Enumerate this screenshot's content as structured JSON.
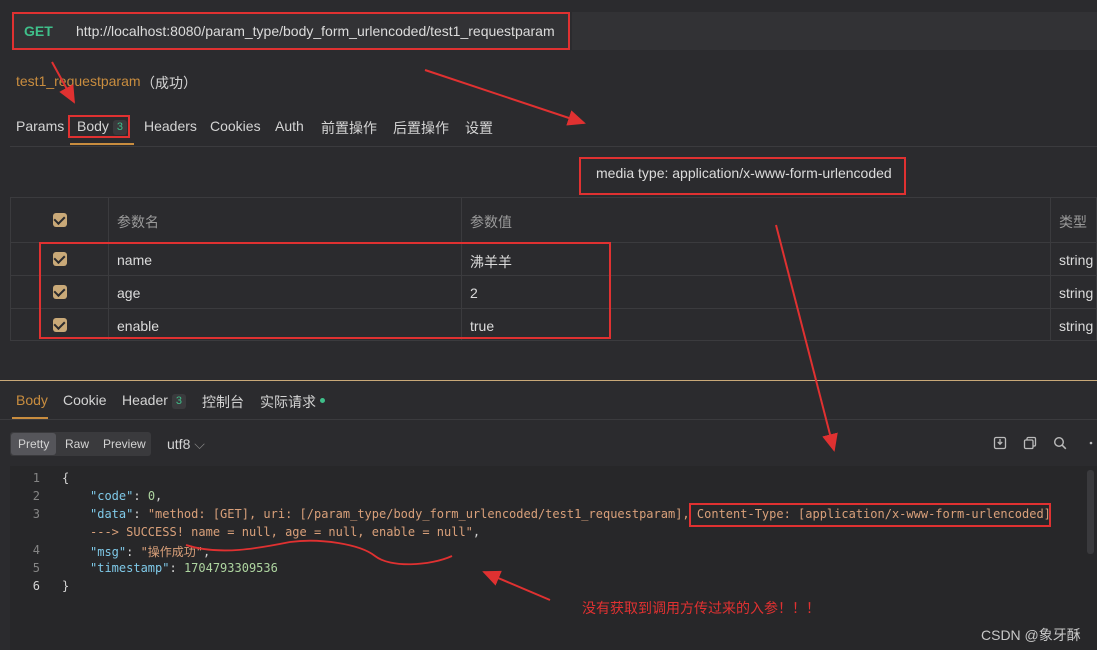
{
  "request": {
    "method": "GET",
    "url": "http://localhost:8080/param_type/body_form_urlencoded/test1_requestparam",
    "name": "test1_requestparam",
    "status": "（成功）"
  },
  "request_tabs": [
    {
      "label": "Params"
    },
    {
      "label": "Body",
      "badge": "3"
    },
    {
      "label": "Headers"
    },
    {
      "label": "Cookies"
    },
    {
      "label": "Auth"
    },
    {
      "label": "前置操作"
    },
    {
      "label": "后置操作"
    },
    {
      "label": "设置"
    }
  ],
  "media_type": "media type: application/x-www-form-urlencoded",
  "params_table": {
    "headers": {
      "name": "参数名",
      "value": "参数值",
      "type": "类型"
    },
    "rows": [
      {
        "checked": true,
        "name": "name",
        "value": "沸羊羊",
        "type": "string"
      },
      {
        "checked": true,
        "name": "age",
        "value": "2",
        "type": "string"
      },
      {
        "checked": true,
        "name": "enable",
        "value": "true",
        "type": "string"
      }
    ]
  },
  "response_tabs": [
    {
      "label": "Body"
    },
    {
      "label": "Cookie"
    },
    {
      "label": "Header",
      "badge": "3"
    },
    {
      "label": "控制台"
    },
    {
      "label": "实际请求"
    }
  ],
  "format_buttons": [
    "Pretty",
    "Raw",
    "Preview"
  ],
  "encoding": "utf8",
  "toolbar_icons": [
    "save-icon",
    "copy-icon",
    "search-icon",
    "more-icon"
  ],
  "code": {
    "line_numbers": [
      "1",
      "2",
      "3",
      "",
      "4",
      "5",
      "6"
    ],
    "brace_open": "{",
    "code_key": "\"code\"",
    "code_val": "0",
    "data_key": "\"data\"",
    "data_val_a": "\"method: [GET], uri: [/param_type/body_form_urlencoded/test1_requestparam], ",
    "data_val_b": "Content-Type: [application/x-www-form-urlencoded]",
    "data_val_c": "---> SUCCESS! name = null, age = null, enable = null\"",
    "msg_key": "\"msg\"",
    "msg_val": "\"操作成功\"",
    "ts_key": "\"timestamp\"",
    "ts_val": "1704793309536",
    "brace_close": "}"
  },
  "annotation": "没有获取到调用方传过来的入参！！！",
  "watermark": "CSDN @象牙酥",
  "colors": {
    "background": "#2b2b2e",
    "method_green": "#3fbf8a",
    "accent": "#c98d3f",
    "highlight_red": "#e03131"
  }
}
